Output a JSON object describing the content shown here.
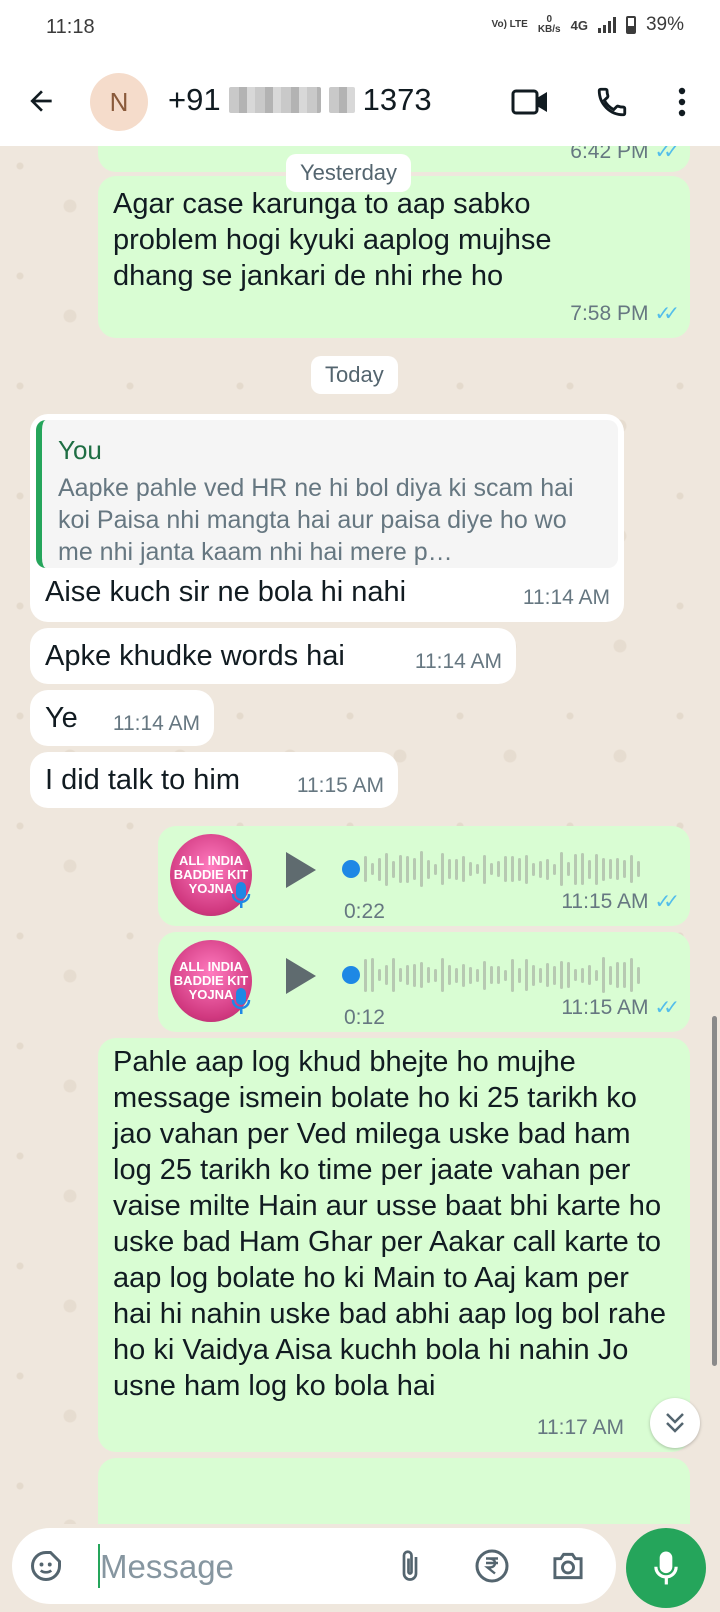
{
  "status_bar": {
    "time": "11:18",
    "volte": "Vo) LTE",
    "speed_value": "0",
    "speed_unit": "KB/s",
    "network": "4G",
    "battery": "39%"
  },
  "header": {
    "avatar_letter": "N",
    "contact_prefix": "+91",
    "contact_suffix": "1373"
  },
  "messages": {
    "m0_time": "6:42 PM",
    "day1": "Yesterday",
    "m1_text": "Agar case karunga to aap sabko problem hogi kyuki aaplog mujhse dhang se jankari de nhi rhe ho",
    "m1_time": "7:58 PM",
    "day2": "Today",
    "reply_name": "You",
    "reply_text": "Aapke pahle ved HR ne hi bol diya ki scam hai koi Paisa nhi mangta hai aur paisa diye ho wo me nhi janta kaam nhi hai mere p…",
    "m2_text": "Aise kuch sir ne bola hi nahi",
    "m2_time": "11:14 AM",
    "m3_text": "Apke khudke words hai",
    "m3_time": "11:14 AM",
    "m4_text": "Ye",
    "m4_time": "11:14 AM",
    "m5_text": "I did talk to him",
    "m5_time": "11:15 AM",
    "v1_duration": "0:22",
    "v1_time": "11:15 AM",
    "v2_duration": "0:12",
    "v2_time": "11:15 AM",
    "m6_text": "Pahle aap log khud bhejte ho mujhe message ismein bolate ho ki 25 tarikh ko jao vahan per Ved milega uske bad ham log 25 tarikh ko time per jaate vahan per vaise milte Hain aur usse baat bhi karte ho uske bad Ham Ghar per Aakar call karte to aap log bolate ho ki Main to Aaj kam per hai hi nahin uske bad abhi aap log bol rahe ho ki Vaidya Aisa kuchh bola hi nahin Jo usne ham log ko bola hai",
    "m6_time": "11:17 AM",
    "thumb_text": "ALL INDIA BADDIE KIT YOJNA"
  },
  "composer": {
    "placeholder": "Message"
  },
  "colors": {
    "outgoing_bubble": "#d9fdd3",
    "incoming_bubble": "#ffffff",
    "accent_green": "#25a55b",
    "read_ticks": "#53bdeb",
    "chat_background": "#efe7dd"
  },
  "icons": [
    "back-arrow-icon",
    "video-call-icon",
    "phone-icon",
    "more-options-icon",
    "sticker-icon",
    "attach-icon",
    "rupee-icon",
    "camera-icon",
    "mic-icon",
    "play-icon",
    "chevron-double-down-icon"
  ]
}
